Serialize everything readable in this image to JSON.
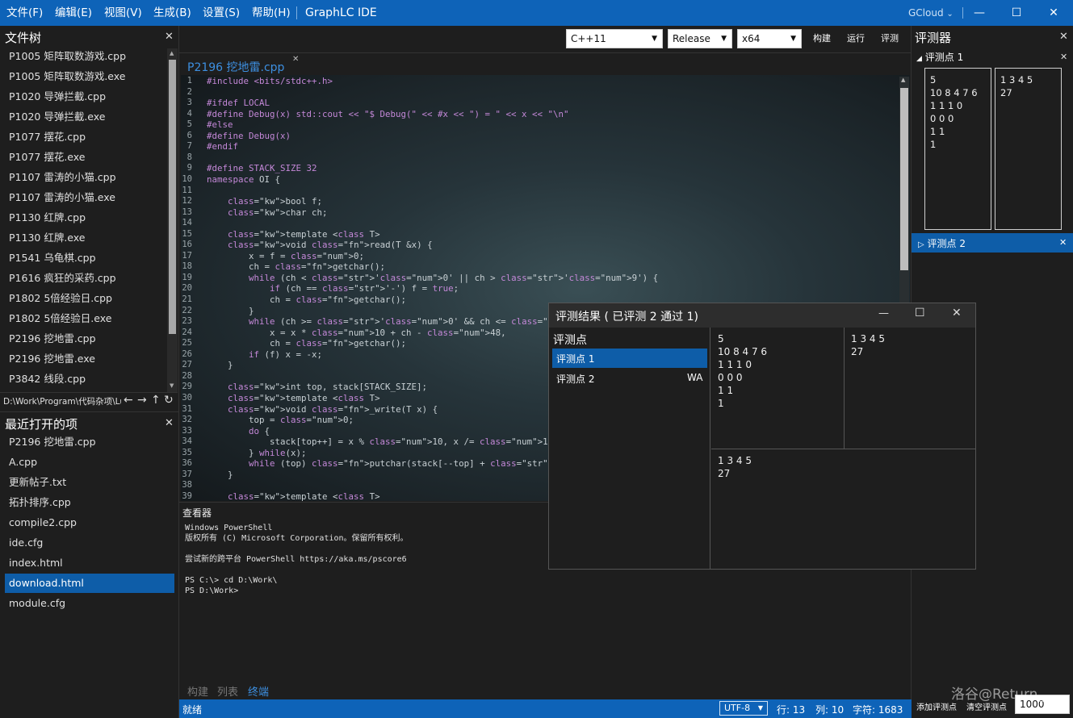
{
  "menu": [
    "文件(F)",
    "编辑(E)",
    "视图(V)",
    "生成(B)",
    "设置(S)",
    "帮助(H)"
  ],
  "app_title": "GraphLC IDE",
  "account": "GCloud",
  "file_tree": {
    "title": "文件树",
    "items": [
      "P1005 矩阵取数游戏.cpp",
      "P1005 矩阵取数游戏.exe",
      "P1020 导弹拦截.cpp",
      "P1020 导弹拦截.exe",
      "P1077 摆花.cpp",
      "P1077 摆花.exe",
      "P1107 雷涛的小猫.cpp",
      "P1107 雷涛的小猫.exe",
      "P1130 红牌.cpp",
      "P1130 红牌.exe",
      "P1541 乌龟棋.cpp",
      "P1616 疯狂的采药.cpp",
      "P1802 5倍经验日.cpp",
      "P1802 5倍经验日.exe",
      "P2196 挖地雷.cpp",
      "P2196 挖地雷.exe",
      "P3842 线段.cpp"
    ],
    "path": "D:\\Work\\Program\\代码杂项\\Lu"
  },
  "recent": {
    "title": "最近打开的项",
    "items": [
      "P2196 挖地雷.cpp",
      "A.cpp",
      "更新帖子.txt",
      "拓扑排序.cpp",
      "compile2.cpp",
      "ide.cfg",
      "index.html",
      "download.html",
      "module.cfg"
    ],
    "selected": 7
  },
  "toolbar": {
    "standard": "C++11",
    "config": "Release",
    "arch": "x64",
    "build": "构建",
    "run": "运行",
    "judge": "评测"
  },
  "editor_tab": "P2196 挖地雷.cpp",
  "code_lines": [
    "#include <bits/stdc++.h>",
    "",
    "#ifdef LOCAL",
    "#define Debug(x) std::cout << \"$ Debug(\" << #x << \") = \" << x << \"\\n\"",
    "#else",
    "#define Debug(x)",
    "#endif",
    "",
    "#define STACK_SIZE 32",
    "namespace OI {",
    "",
    "    bool f;",
    "    char ch;",
    "",
    "    template <class T>",
    "    void read(T &x) {",
    "        x = f = 0;",
    "        ch = getchar();",
    "        while (ch < '0' || ch > '9') {",
    "            if (ch == '-') f = true;",
    "            ch = getchar();",
    "        }",
    "        while (ch >= '0' && ch <= '9')",
    "            x = x * 10 + ch - 48,",
    "            ch = getchar();",
    "        if (f) x = -x;",
    "    }",
    "",
    "    int top, stack[STACK_SIZE];",
    "    template <class T>",
    "    void _write(T x) {",
    "        top = 0;",
    "        do {",
    "            stack[top++] = x % 10, x /= 10;",
    "        } while(x);",
    "        while (top) putchar(stack[--top] + '0');",
    "    }",
    "",
    "    template <class T>"
  ],
  "viewer": {
    "title": "查看器",
    "terminal": "Windows PowerShell\n版权所有 (C) Microsoft Corporation。保留所有权利。\n\n尝试新的跨平台 PowerShell https://aka.ms/pscore6\n\nPS C:\\> cd D:\\Work\\\nPS D:\\Work>",
    "tabs": [
      "构建",
      "列表",
      "终端"
    ],
    "active_tab": 2
  },
  "judger": {
    "title": "评测器",
    "case1_label": "评测点 1",
    "case1_input": "5\n10 8 4 7 6\n1 1 1 0\n0 0 0\n1 1\n1",
    "case1_output": "1 3 4 5\n27",
    "case2_label": "评测点 2",
    "add_button": "添加评测点",
    "clear_button": "清空评测点",
    "time_limit": "1000"
  },
  "judge_result": {
    "title": "评测结果 ( 已评测 2 通过 1)",
    "list_title": "评测点",
    "cases": [
      {
        "label": "评测点 1",
        "status": ""
      },
      {
        "label": "评测点 2",
        "status": "WA"
      }
    ],
    "input": "5\n10 8 4 7 6\n1 1 1 0\n0 0 0\n1 1\n1",
    "expected": "1 3 4 5\n27",
    "actual": "1 3 4 5\n27"
  },
  "status": {
    "state": "就绪",
    "encoding": "UTF-8",
    "line": "行: 13",
    "col": "列: 10",
    "chars": "字符: 1683"
  },
  "watermark": "洛谷@Return_"
}
